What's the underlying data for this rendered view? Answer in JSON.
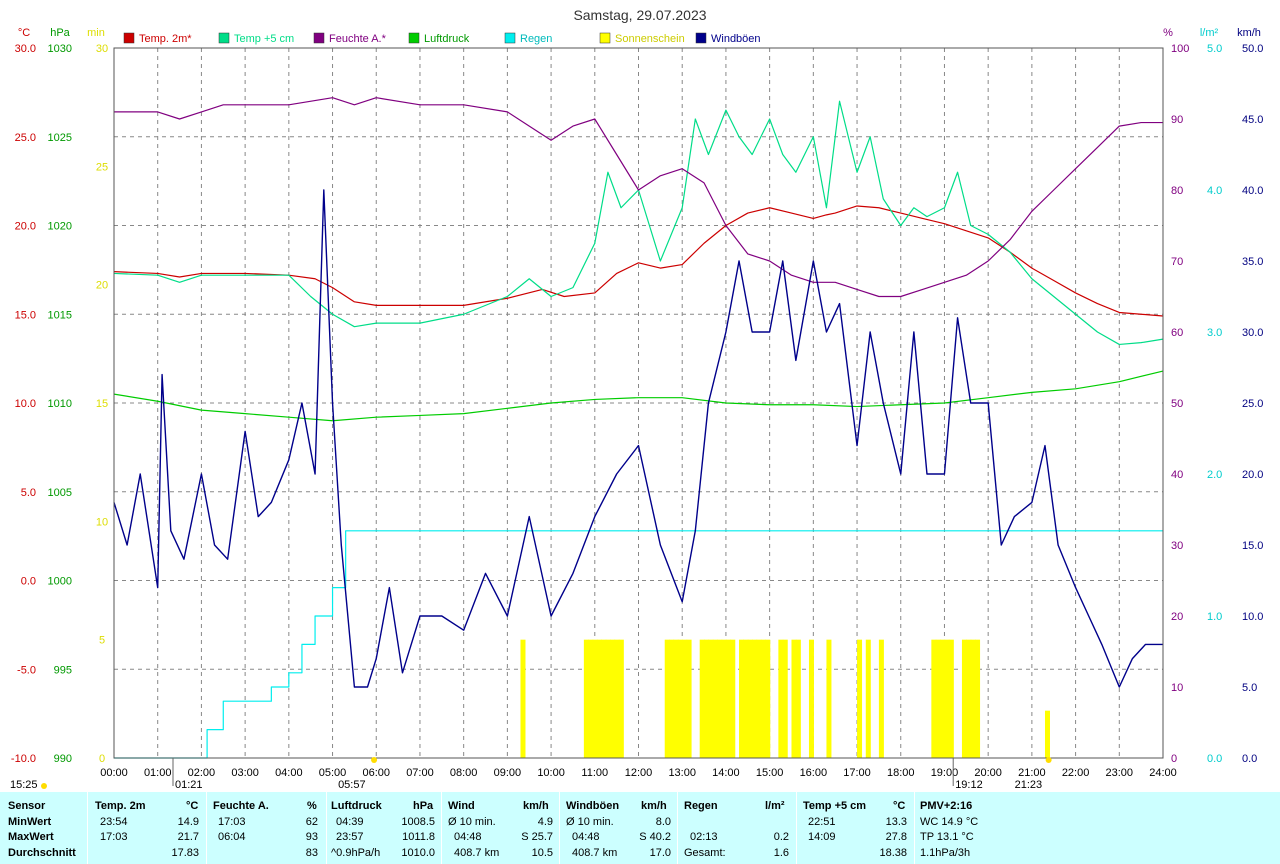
{
  "chart_data": {
    "type": "line",
    "title": "Samstag, 29.07.2023",
    "x_ticks": [
      "00:00",
      "01:00",
      "02:00",
      "03:00",
      "04:00",
      "05:00",
      "06:00",
      "07:00",
      "08:00",
      "09:00",
      "10:00",
      "11:00",
      "12:00",
      "13:00",
      "14:00",
      "15:00",
      "16:00",
      "17:00",
      "18:00",
      "19:00",
      "20:00",
      "21:00",
      "22:00",
      "23:00",
      "24:00"
    ],
    "x_range_hours": [
      0,
      24
    ],
    "grid": true,
    "legend_position": "top",
    "axes": {
      "temp": {
        "unit": "°C",
        "range": [
          -10,
          30
        ],
        "ticks": [
          "30.0",
          "25.0",
          "20.0",
          "15.0",
          "10.0",
          "5.0",
          "0.0",
          "-5.0",
          "-10.0"
        ],
        "color": "#cc0000"
      },
      "pressure": {
        "unit": "hPa",
        "range": [
          990,
          1030
        ],
        "ticks": [
          "1030",
          "1025",
          "1020",
          "1015",
          "1010",
          "1005",
          "1000",
          "995",
          "990"
        ],
        "color": "#009900"
      },
      "sun": {
        "unit": "min",
        "range": [
          0,
          30
        ],
        "ticks": [
          "30",
          "25",
          "20",
          "15",
          "10",
          "5",
          "0"
        ],
        "color": "#dddd00"
      },
      "humidity": {
        "unit": "%",
        "range": [
          0,
          100
        ],
        "ticks": [
          "100",
          "90",
          "80",
          "70",
          "60",
          "50",
          "40",
          "30",
          "20",
          "10",
          "0"
        ],
        "color": "#800080"
      },
      "rain": {
        "unit": "l/m²",
        "range": [
          0,
          5
        ],
        "ticks": [
          "5.0",
          "4.0",
          "3.0",
          "2.0",
          "1.0",
          "0.0"
        ],
        "color": "#00cccc"
      },
      "wind": {
        "unit": "km/h",
        "range": [
          0,
          50
        ],
        "ticks": [
          "50.0",
          "45.0",
          "40.0",
          "35.0",
          "30.0",
          "25.0",
          "20.0",
          "15.0",
          "10.0",
          "5.0",
          "0.0"
        ],
        "color": "#000080"
      }
    },
    "sun_markers": {
      "sunrise": "05:57",
      "sunset": "21:23",
      "moonset": "01:21",
      "moonrise": "19:12"
    },
    "series": [
      {
        "name": "Temp. 2m*",
        "axis": "temp",
        "color": "#cc0000",
        "x": [
          0,
          1,
          1.5,
          2,
          3,
          4,
          4.6,
          5,
          5.5,
          6,
          7,
          8,
          9,
          9.8,
          10.3,
          11,
          11.5,
          12,
          12.5,
          13,
          13.5,
          14,
          14.5,
          15,
          15.5,
          16,
          16.3,
          16.5,
          17,
          17.5,
          18,
          18.5,
          19,
          19.5,
          20,
          20.5,
          21,
          21.5,
          22,
          22.5,
          23,
          23.5,
          24
        ],
        "y": [
          17.4,
          17.3,
          17.1,
          17.3,
          17.3,
          17.2,
          17.0,
          16.5,
          15.7,
          15.5,
          15.5,
          15.5,
          15.9,
          16.4,
          16.0,
          16.2,
          17.3,
          17.9,
          17.6,
          17.8,
          19.0,
          20.0,
          20.7,
          21.0,
          20.7,
          20.4,
          20.6,
          20.7,
          21.1,
          21.0,
          20.7,
          20.4,
          20.1,
          19.7,
          19.3,
          18.5,
          17.6,
          16.9,
          16.2,
          15.6,
          15.1,
          15.0,
          14.9
        ]
      },
      {
        "name": "Temp +5 cm",
        "axis": "temp",
        "color": "#00dd88",
        "x": [
          0,
          1,
          1.5,
          2,
          3,
          4,
          4.5,
          5,
          5.5,
          6,
          7,
          8,
          9,
          9.5,
          10,
          10.5,
          11,
          11.3,
          11.6,
          12,
          12.5,
          13,
          13.3,
          13.6,
          14,
          14.3,
          14.6,
          15,
          15.3,
          15.6,
          16,
          16.3,
          16.6,
          17,
          17.3,
          17.6,
          18,
          18.3,
          18.6,
          19,
          19.3,
          19.6,
          20,
          20.5,
          21,
          21.5,
          22,
          22.5,
          23,
          23.5,
          24
        ],
        "y": [
          17.3,
          17.2,
          16.8,
          17.2,
          17.2,
          17.2,
          16.0,
          15.0,
          14.3,
          14.5,
          14.5,
          15.0,
          16.0,
          17.0,
          16.0,
          16.5,
          19.0,
          23.0,
          21.0,
          22.0,
          18.0,
          21.0,
          26.0,
          24.0,
          26.5,
          25.0,
          24.0,
          26.0,
          24.0,
          23.0,
          25.0,
          21.0,
          27.0,
          23.0,
          25.0,
          21.5,
          20.0,
          21.0,
          20.5,
          21.0,
          23.0,
          20.0,
          19.5,
          18.5,
          17.0,
          16.0,
          15.0,
          14.0,
          13.3,
          13.4,
          13.6
        ]
      },
      {
        "name": "Feuchte A.*",
        "axis": "humidity",
        "color": "#800080",
        "x": [
          0,
          1,
          1.5,
          2,
          2.5,
          3,
          4,
          5,
          5.5,
          6,
          7,
          8,
          9,
          10,
          10.5,
          11,
          11.5,
          12,
          12.5,
          13,
          13.5,
          14,
          14.5,
          15,
          15.5,
          16,
          16.5,
          17,
          17.5,
          18,
          18.5,
          19,
          19.5,
          20,
          20.5,
          21,
          21.5,
          22,
          22.5,
          23,
          23.5,
          24
        ],
        "y": [
          91,
          91,
          90,
          91,
          92,
          92,
          92,
          93,
          92,
          93,
          92,
          92,
          91,
          87,
          89,
          90,
          85,
          80,
          82,
          83,
          81,
          75,
          71,
          70,
          68,
          67,
          67,
          66,
          65,
          65,
          66,
          67,
          68,
          70,
          73,
          77,
          80,
          83,
          86,
          89,
          89.5,
          89.5
        ]
      },
      {
        "name": "Luftdruck",
        "axis": "pressure",
        "color": "#00cc00",
        "x": [
          0,
          1,
          2,
          3,
          4,
          5,
          6,
          7,
          8,
          9,
          10,
          11,
          12,
          13,
          14,
          15,
          16,
          17,
          18,
          19,
          20,
          21,
          22,
          23,
          24
        ],
        "y": [
          1010.5,
          1010.1,
          1009.6,
          1009.4,
          1009.2,
          1009.0,
          1009.2,
          1009.3,
          1009.4,
          1009.7,
          1010.0,
          1010.2,
          1010.3,
          1010.3,
          1010.0,
          1009.9,
          1009.9,
          1009.8,
          1009.9,
          1010.0,
          1010.3,
          1010.6,
          1010.8,
          1011.2,
          1011.8
        ]
      },
      {
        "name": "Regen",
        "axis": "rain",
        "color": "#00eeee",
        "type": "step",
        "x": [
          0,
          2.13,
          2.5,
          3,
          3.6,
          4,
          4.3,
          4.6,
          5,
          5.3,
          24
        ],
        "y": [
          0,
          0.2,
          0.4,
          0.4,
          0.5,
          0.6,
          0.8,
          1.0,
          1.2,
          1.6,
          1.6
        ]
      },
      {
        "name": "Sonnenschein",
        "axis": "sun",
        "color": "#ffff00",
        "type": "bar",
        "x": [
          9.3,
          10.75,
          10.85,
          10.95,
          11.05,
          11.15,
          11.25,
          11.35,
          11.45,
          11.55,
          12.6,
          12.7,
          12.8,
          12.9,
          13.0,
          13.1,
          13.4,
          13.5,
          13.6,
          13.7,
          13.8,
          13.9,
          14.0,
          14.1,
          14.3,
          14.4,
          14.5,
          14.6,
          14.7,
          14.8,
          14.9,
          15.2,
          15.3,
          15.5,
          15.6,
          15.9,
          16.3,
          17.0,
          17.2,
          17.5,
          18.7,
          18.8,
          18.9,
          19.0,
          19.1,
          19.4,
          19.5,
          19.6,
          19.7,
          21.3
        ],
        "y": [
          5,
          5,
          5,
          5,
          5,
          5,
          5,
          5,
          5,
          5,
          5,
          5,
          5,
          5,
          5,
          5,
          5,
          5,
          5,
          5,
          5,
          5,
          5,
          5,
          5,
          5,
          5,
          5,
          5,
          5,
          5,
          5,
          5,
          5,
          5,
          5,
          5,
          5,
          5,
          5,
          5,
          5,
          5,
          5,
          5,
          5,
          5,
          5,
          5,
          2
        ]
      },
      {
        "name": "Windböen",
        "axis": "wind",
        "color": "#00008b",
        "x": [
          0,
          0.3,
          0.6,
          1.0,
          1.1,
          1.3,
          1.6,
          2.0,
          2.3,
          2.6,
          3.0,
          3.3,
          3.6,
          4.0,
          4.3,
          4.6,
          4.8,
          5.0,
          5.2,
          5.5,
          5.8,
          6.0,
          6.3,
          6.6,
          7.0,
          7.5,
          8.0,
          8.5,
          9.0,
          9.5,
          10.0,
          10.5,
          11.0,
          11.5,
          12.0,
          12.5,
          13.0,
          13.3,
          13.6,
          14.0,
          14.3,
          14.6,
          15.0,
          15.3,
          15.6,
          16.0,
          16.3,
          16.6,
          17.0,
          17.3,
          17.6,
          18.0,
          18.3,
          18.6,
          19.0,
          19.3,
          19.6,
          20.0,
          20.3,
          20.6,
          21.0,
          21.3,
          21.6,
          22.0,
          22.3,
          22.6,
          23.0,
          23.3,
          23.6,
          24.0
        ],
        "y": [
          18,
          15,
          20,
          12,
          27,
          16,
          14,
          20,
          15,
          14,
          23,
          17,
          18,
          21,
          25,
          20,
          40,
          25,
          15,
          5,
          5,
          7,
          12,
          6,
          10,
          10,
          9,
          13,
          10,
          17,
          10,
          13,
          17,
          20,
          22,
          15,
          11,
          16,
          25,
          30,
          35,
          30,
          30,
          35,
          28,
          35,
          30,
          32,
          22,
          30,
          25,
          20,
          30,
          20,
          20,
          31,
          25,
          25,
          15,
          17,
          18,
          22,
          15,
          12,
          10,
          8,
          5,
          7,
          8,
          8
        ]
      }
    ]
  },
  "stats": {
    "headers": {
      "sensor": "Sensor",
      "temp2m": "Temp. 2m",
      "temp2m_unit": "°C",
      "humidity": "Feuchte A.",
      "humidity_unit": "%",
      "pressure": "Luftdruck",
      "pressure_unit": "hPa",
      "wind": "Wind",
      "wind_unit": "km/h",
      "gust": "Windböen",
      "gust_unit": "km/h",
      "rain": "Regen",
      "rain_unit": "l/m²",
      "temp5": "Temp +5 cm",
      "temp5_unit": "°C",
      "pmv": "PMV+2:16"
    },
    "row_labels": [
      "MinWert",
      "MaxWert",
      "Durchschnitt"
    ],
    "temp2m": {
      "min_time": "23:54",
      "min": "14.9",
      "max_time": "17:03",
      "max": "21.7",
      "avg": "17.83"
    },
    "humidity": {
      "min_time": "17:03",
      "min": "62",
      "max_time": "06:04",
      "max": "93",
      "avg": "83"
    },
    "pressure": {
      "min_time": "04:39",
      "min": "1008.5",
      "max_time": "23:57",
      "max": "1011.8",
      "trend": "^0.9hPa/h",
      "avg": "1010.0"
    },
    "wind": {
      "r1_a": "Ø 10 min.",
      "r1_b": "4.9",
      "r2_a": "04:48",
      "r2_b": "S 25.7",
      "r3_a": "408.7 km",
      "r3_b": "10.5"
    },
    "gust": {
      "r1_a": "Ø 10 min.",
      "r1_b": "8.0",
      "r2_a": "04:48",
      "r2_b": "S 40.2",
      "r3_a": "408.7 km",
      "r3_b": "17.0"
    },
    "rain": {
      "max_time": "02:13",
      "max": "0.2",
      "total_label": "Gesamt:",
      "total": "1.6"
    },
    "temp5": {
      "min_time": "22:51",
      "min": "13.3",
      "max_time": "14:09",
      "max": "27.8",
      "avg": "18.38"
    },
    "pmv": {
      "r1": "WC 14.9 °C",
      "r2": "TP 13.1 °C",
      "r3": "1.1hPa/3h"
    },
    "bottom_left_time": "15:25"
  }
}
